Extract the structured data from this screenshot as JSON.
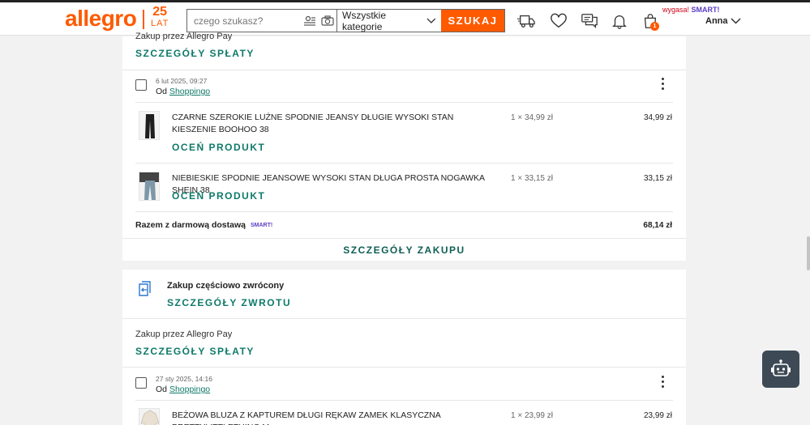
{
  "header": {
    "logo": "allegro",
    "anniv_num": "25",
    "anniv_text": "LAT",
    "search_placeholder": "czego szukasz?",
    "category": "Wszystkie kategorie",
    "search_button": "SZUKAJ",
    "expired_text": "wygasa!",
    "smart_label": "SMART!",
    "cart_count": "1",
    "user_name": "Anna"
  },
  "top_card": {
    "payment_text": "Zakup przez Allegro Pay",
    "repayment_link": "SZCZEGÓŁY SPŁATY",
    "order": {
      "date": "6 lut 2025, 09:27",
      "from_prefix": "Od",
      "seller": "Shoppingo",
      "items": [
        {
          "name": "CZARNE SZEROKIE LUŹNE SPODNIE JEANSY DŁUGIE WYSOKI STAN KIESZENIE BOOHOO 38",
          "qty": "1 × 34,99 zł",
          "price": "34,99 zł",
          "rate": "OCEŃ PRODUKT"
        },
        {
          "name": "NIEBIESKIE SPODNIE JEANSOWE WYSOKI STAN DŁUGA PROSTA NOGAWKA SHEIN 38",
          "qty": "1 × 33,15 zł",
          "price": "33,15 zł",
          "rate": "OCEŃ PRODUKT"
        }
      ],
      "total_label": "Razem z darmową dostawą",
      "smart_mini": "SMART!",
      "total": "68,14 zł",
      "details_button": "SZCZEGÓŁY ZAKUPU"
    }
  },
  "return_card": {
    "status": "Zakup częściowo zwrócony",
    "return_link": "SZCZEGÓŁY ZWROTU",
    "payment_text": "Zakup przez Allegro Pay",
    "repayment_link": "SZCZEGÓŁY SPŁATY",
    "order": {
      "date": "27 sty 2025, 14:16",
      "from_prefix": "Od",
      "seller": "Shoppingo",
      "items": [
        {
          "name": "BEŻOWA BLUZA Z KAPTUREM DŁUGI RĘKAW ZAMEK KLASYCZNA PRETTYLITTLETHING M",
          "qty": "1 × 23,99 zł",
          "price": "23,99 zł"
        }
      ]
    }
  },
  "colors": {
    "brand": "#ff5a00",
    "link": "#0f7a6a",
    "smart": "#5b3cc4"
  }
}
